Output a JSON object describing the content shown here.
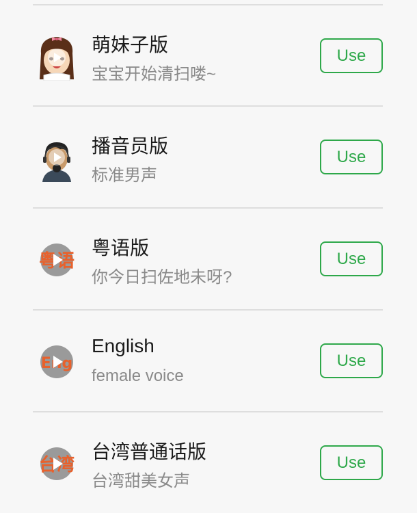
{
  "voices": [
    {
      "title": "萌妹子版",
      "subtitle": "宝宝开始清扫喽~",
      "button": "Use",
      "icon": "girl-avatar-icon"
    },
    {
      "title": "播音员版",
      "subtitle": "标准男声",
      "button": "Use",
      "icon": "announcer-avatar-icon"
    },
    {
      "title": "粤语版",
      "subtitle": "你今日扫佐地未呀?",
      "button": "Use",
      "icon": "cantonese-badge-icon",
      "badge": "粤语"
    },
    {
      "title": "English",
      "subtitle": "female voice",
      "button": "Use",
      "icon": "english-badge-icon",
      "badge": "Eng"
    },
    {
      "title": "台湾普通话版",
      "subtitle": "台湾甜美女声",
      "button": "Use",
      "icon": "taiwan-badge-icon",
      "badge": "台湾"
    }
  ],
  "colors": {
    "accent": "#2ea84a",
    "badge_text": "#e8612c",
    "play_circle": "#9a9a9a",
    "background": "#f7f7f7"
  }
}
